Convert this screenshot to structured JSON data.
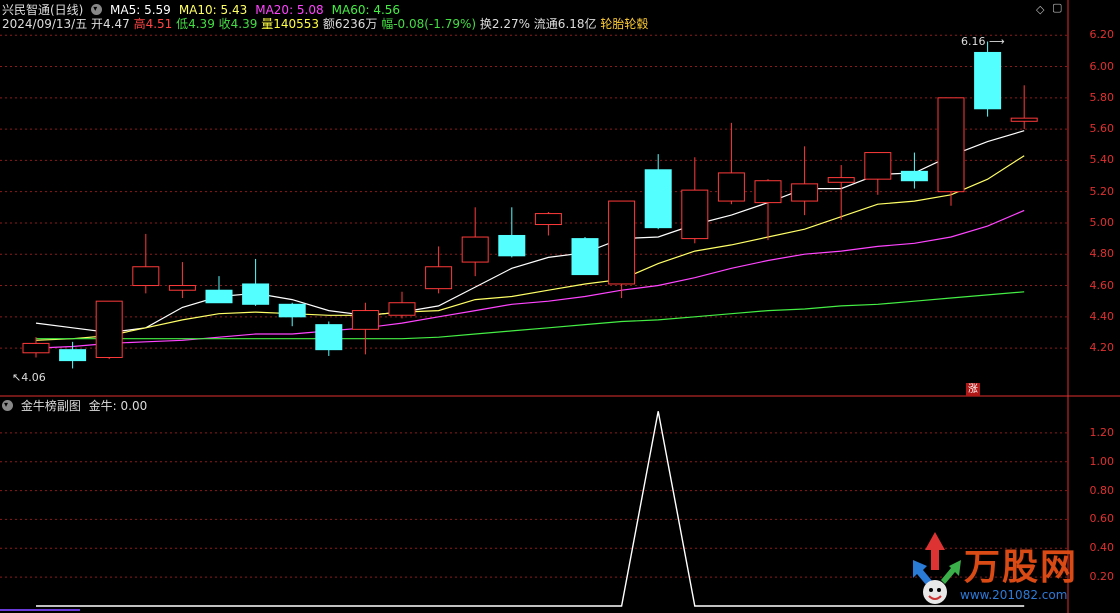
{
  "header": {
    "title": "兴民智通(日线)",
    "ma_labels": [
      {
        "text": "MA5: 5.59",
        "color": "#ffffff"
      },
      {
        "text": "MA10: 5.43",
        "color": "#ffff66"
      },
      {
        "text": "MA20: 5.08",
        "color": "#ff44ff"
      },
      {
        "text": "MA60: 4.56",
        "color": "#44ee44"
      }
    ],
    "quote": [
      {
        "text": "2024/09/13/五 开4.47 ",
        "color": "#dddddd"
      },
      {
        "text": "高4.51 ",
        "color": "#ff4444"
      },
      {
        "text": "低4.39 ",
        "color": "#44dd44"
      },
      {
        "text": "收4.39 ",
        "color": "#44dd44"
      },
      {
        "text": "量140553 ",
        "color": "#ffff44"
      },
      {
        "text": "额6236万 ",
        "color": "#dddddd"
      },
      {
        "text": "幅-0.08(-1.79%) ",
        "color": "#44dd44"
      },
      {
        "text": "换2.27% 流通6.18亿 ",
        "color": "#dddddd"
      },
      {
        "text": "轮胎轮毂",
        "color": "#ffcc33"
      }
    ]
  },
  "sub_header": {
    "indicator": "金牛榜副图",
    "value_label": "金牛: 0.00"
  },
  "annotations": {
    "high_label": "6.16",
    "low_label": "4.06",
    "badge": "涨"
  },
  "watermark": {
    "brand": "万股网",
    "url": "www.201082.com"
  },
  "colors": {
    "up": "#ff3a3a",
    "down": "#54ffff",
    "grid": "#8b1a1a",
    "axis": "#e03030",
    "ma5": "#ffffff",
    "ma10": "#ffff66",
    "ma20": "#ff44ff",
    "ma60": "#44ee44",
    "indicator": "#ffffff"
  },
  "chart_data": [
    {
      "type": "candlestick",
      "title": "兴民智通(日线)",
      "ylim": [
        4.06,
        6.24
      ],
      "yticks": [
        4.2,
        4.4,
        4.6,
        4.8,
        5.0,
        5.2,
        5.4,
        5.6,
        5.8,
        6.0,
        6.2
      ],
      "candles": [
        {
          "o": 4.17,
          "h": 4.27,
          "l": 4.14,
          "c": 4.23
        },
        {
          "o": 4.19,
          "h": 4.24,
          "l": 4.07,
          "c": 4.12
        },
        {
          "o": 4.14,
          "h": 4.5,
          "l": 4.13,
          "c": 4.5
        },
        {
          "o": 4.6,
          "h": 4.93,
          "l": 4.55,
          "c": 4.72
        },
        {
          "o": 4.57,
          "h": 4.75,
          "l": 4.52,
          "c": 4.6
        },
        {
          "o": 4.57,
          "h": 4.66,
          "l": 4.49,
          "c": 4.49
        },
        {
          "o": 4.61,
          "h": 4.77,
          "l": 4.47,
          "c": 4.48
        },
        {
          "o": 4.48,
          "h": 4.49,
          "l": 4.34,
          "c": 4.4
        },
        {
          "o": 4.35,
          "h": 4.37,
          "l": 4.15,
          "c": 4.19
        },
        {
          "o": 4.32,
          "h": 4.49,
          "l": 4.16,
          "c": 4.44
        },
        {
          "o": 4.41,
          "h": 4.56,
          "l": 4.39,
          "c": 4.49
        },
        {
          "o": 4.58,
          "h": 4.85,
          "l": 4.55,
          "c": 4.72
        },
        {
          "o": 4.75,
          "h": 5.1,
          "l": 4.66,
          "c": 4.91
        },
        {
          "o": 4.92,
          "h": 5.1,
          "l": 4.78,
          "c": 4.79
        },
        {
          "o": 4.99,
          "h": 5.07,
          "l": 4.92,
          "c": 5.06
        },
        {
          "o": 4.9,
          "h": 4.91,
          "l": 4.67,
          "c": 4.67
        },
        {
          "o": 4.61,
          "h": 5.13,
          "l": 4.52,
          "c": 5.14
        },
        {
          "o": 5.34,
          "h": 5.44,
          "l": 4.96,
          "c": 4.97
        },
        {
          "o": 4.9,
          "h": 5.42,
          "l": 4.87,
          "c": 5.21
        },
        {
          "o": 5.14,
          "h": 5.64,
          "l": 5.12,
          "c": 5.32
        },
        {
          "o": 5.13,
          "h": 5.28,
          "l": 4.89,
          "c": 5.27
        },
        {
          "o": 5.14,
          "h": 5.49,
          "l": 5.05,
          "c": 5.25
        },
        {
          "o": 5.26,
          "h": 5.37,
          "l": 5.02,
          "c": 5.29
        },
        {
          "o": 5.28,
          "h": 5.41,
          "l": 5.18,
          "c": 5.45
        },
        {
          "o": 5.33,
          "h": 5.45,
          "l": 5.22,
          "c": 5.27
        },
        {
          "o": 5.2,
          "h": 5.8,
          "l": 5.11,
          "c": 5.8
        },
        {
          "o": 6.09,
          "h": 6.16,
          "l": 5.68,
          "c": 5.73
        },
        {
          "o": 5.65,
          "h": 5.88,
          "l": 5.6,
          "c": 5.67
        }
      ],
      "series": [
        {
          "name": "MA5",
          "values": [
            4.36,
            4.33,
            4.3,
            4.33,
            4.46,
            4.53,
            4.55,
            4.51,
            4.44,
            4.41,
            4.43,
            4.47,
            4.59,
            4.71,
            4.78,
            4.81,
            4.9,
            4.91,
            4.99,
            5.05,
            5.13,
            5.22,
            5.22,
            5.31,
            5.32,
            5.43,
            5.52,
            5.59
          ]
        },
        {
          "name": "MA10",
          "values": [
            4.25,
            4.26,
            4.28,
            4.33,
            4.38,
            4.42,
            4.43,
            4.42,
            4.41,
            4.41,
            4.43,
            4.44,
            4.51,
            4.53,
            4.57,
            4.61,
            4.64,
            4.74,
            4.82,
            4.86,
            4.91,
            4.96,
            5.04,
            5.12,
            5.14,
            5.18,
            5.28,
            5.43
          ]
        },
        {
          "name": "MA20",
          "values": [
            4.2,
            4.21,
            4.23,
            4.24,
            4.25,
            4.27,
            4.29,
            4.29,
            4.31,
            4.33,
            4.36,
            4.4,
            4.44,
            4.48,
            4.5,
            4.53,
            4.57,
            4.6,
            4.65,
            4.71,
            4.76,
            4.8,
            4.82,
            4.85,
            4.87,
            4.91,
            4.98,
            5.08
          ]
        },
        {
          "name": "MA60",
          "values": [
            4.26,
            4.26,
            4.26,
            4.26,
            4.26,
            4.26,
            4.26,
            4.26,
            4.26,
            4.26,
            4.26,
            4.27,
            4.29,
            4.31,
            4.33,
            4.35,
            4.37,
            4.38,
            4.4,
            4.42,
            4.44,
            4.45,
            4.47,
            4.48,
            4.5,
            4.52,
            4.54,
            4.56
          ]
        }
      ]
    },
    {
      "type": "line",
      "title": "金牛榜副图",
      "ylim": [
        0,
        1.4
      ],
      "yticks": [
        0.2,
        0.4,
        0.6,
        0.8,
        1.0,
        1.2
      ],
      "series": [
        {
          "name": "金牛",
          "values": [
            0,
            0,
            0,
            0,
            0,
            0,
            0,
            0,
            0,
            0,
            0,
            0,
            0,
            0,
            0,
            0,
            0,
            1.35,
            0,
            0,
            0,
            0,
            0,
            0,
            0,
            0,
            0,
            0
          ]
        }
      ]
    }
  ]
}
